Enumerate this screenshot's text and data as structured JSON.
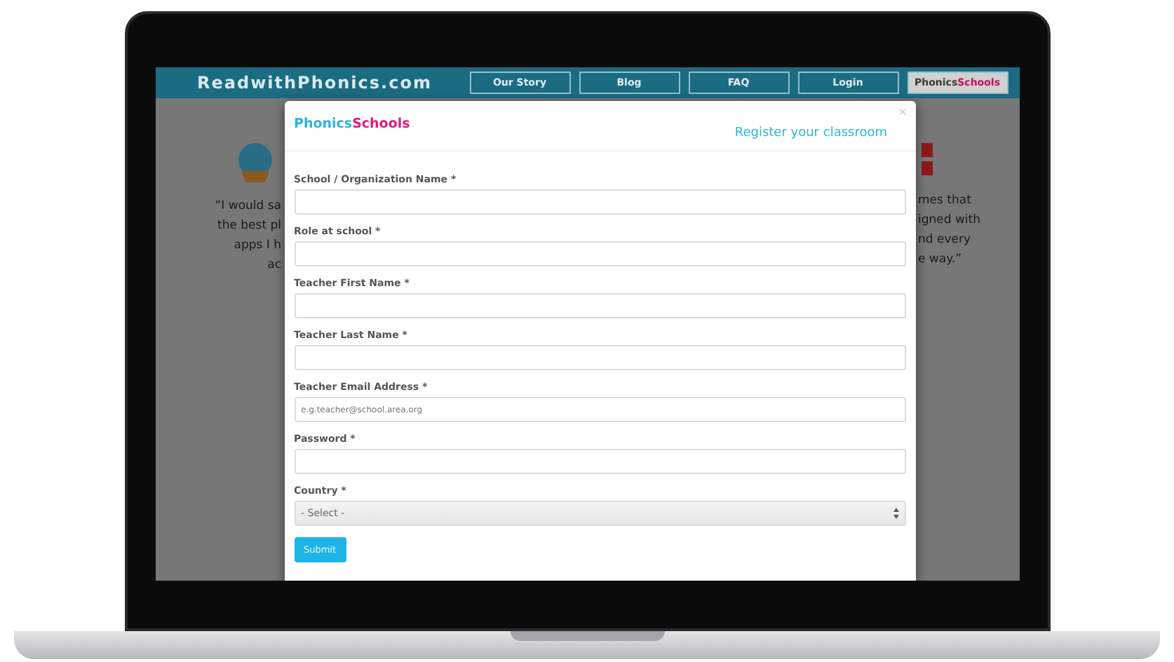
{
  "site": {
    "title": "ReadwithPhonics.com",
    "nav": [
      {
        "label": "Our Story",
        "kind": "plain",
        "selected": false
      },
      {
        "label": "Blog",
        "kind": "plain",
        "selected": false
      },
      {
        "label": "FAQ",
        "kind": "plain",
        "selected": false
      },
      {
        "label": "Login",
        "kind": "plain",
        "selected": false
      },
      {
        "kind": "brand",
        "first": "Phonics",
        "second": "Schools",
        "selected": true
      }
    ],
    "quote_left": [
      "“I would sa",
      "the best pl",
      "apps I h",
      "ac"
    ],
    "quote_right": [
      "mes that",
      "igned with",
      "nd every",
      "e way.”"
    ]
  },
  "modal": {
    "brand": {
      "first": "Phonics",
      "second": "Schools"
    },
    "close": "×",
    "link": "Register your classroom",
    "fields": [
      {
        "label": "School / Organization Name *",
        "kind": "text"
      },
      {
        "label": "Role at school *",
        "kind": "text"
      },
      {
        "label": "Teacher First Name *",
        "kind": "text"
      },
      {
        "label": "Teacher Last Name *",
        "kind": "text"
      },
      {
        "label": "Teacher Email Address *",
        "kind": "text",
        "placeholder": "e.g.teacher@school.area.org"
      },
      {
        "label": "Password *",
        "kind": "password"
      },
      {
        "label": "Country *",
        "kind": "select",
        "value": "- Select -"
      }
    ],
    "submit": "Submit"
  }
}
